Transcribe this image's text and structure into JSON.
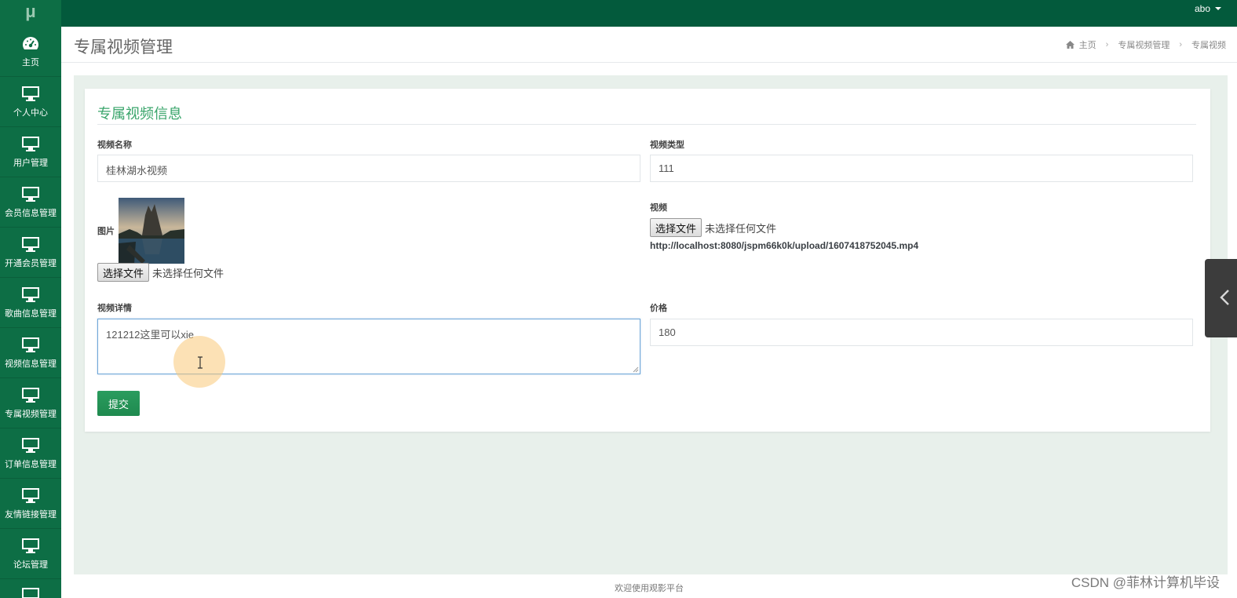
{
  "app": {
    "logo": "μ",
    "user": "abo"
  },
  "sidebar": {
    "items": [
      {
        "label": "主页",
        "icon": "dashboard-icon"
      },
      {
        "label": "个人中心",
        "icon": "monitor-icon"
      },
      {
        "label": "用户管理",
        "icon": "monitor-icon"
      },
      {
        "label": "会员信息管理",
        "icon": "monitor-icon"
      },
      {
        "label": "开通会员管理",
        "icon": "monitor-icon"
      },
      {
        "label": "歌曲信息管理",
        "icon": "monitor-icon"
      },
      {
        "label": "视频信息管理",
        "icon": "monitor-icon"
      },
      {
        "label": "专属视频管理",
        "icon": "monitor-icon"
      },
      {
        "label": "订单信息管理",
        "icon": "monitor-icon"
      },
      {
        "label": "友情链接管理",
        "icon": "monitor-icon"
      },
      {
        "label": "论坛管理",
        "icon": "monitor-icon"
      }
    ]
  },
  "header": {
    "title": "专属视频管理",
    "breadcrumb": [
      "主页",
      "专属视频管理",
      "专属视频"
    ]
  },
  "form": {
    "title": "专属视频信息",
    "name_label": "视频名称",
    "name_value": "桂林湖水视频",
    "type_label": "视频类型",
    "type_value": "111",
    "image_label": "图片",
    "video_label": "视频",
    "file_button": "选择文件",
    "no_file": "未选择任何文件",
    "video_url": "http://localhost:8080/jspm66k0k/upload/1607418752045.mp4",
    "detail_label": "视频详情",
    "detail_value": "121212这里可以xie",
    "price_label": "价格",
    "price_value": "180",
    "submit_label": "提交"
  },
  "footer": {
    "text": "欢迎使用观影平台"
  },
  "watermark": "CSDN @菲林计算机毕设",
  "colors": {
    "topbar": "#035a3c",
    "sidebar": "#0d6e45",
    "accent": "#3aa56b",
    "button": "#1f8a4f"
  }
}
